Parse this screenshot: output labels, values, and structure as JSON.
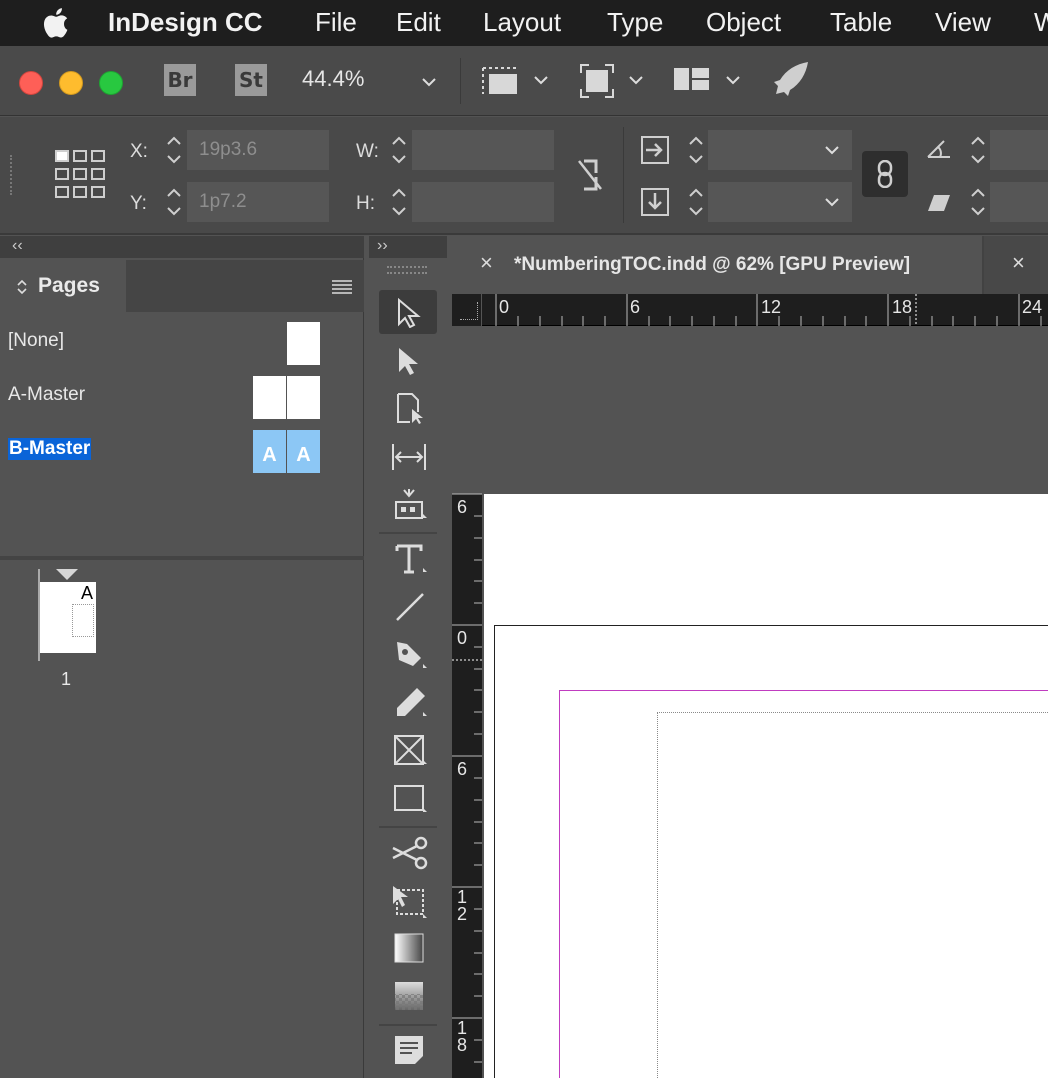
{
  "menubar": {
    "apple_icon": "apple-icon",
    "app_name": "InDesign CC",
    "items": [
      "File",
      "Edit",
      "Layout",
      "Type",
      "Object",
      "Table",
      "View",
      "W"
    ]
  },
  "appbar": {
    "bridge_label": "Br",
    "stock_label": "St",
    "zoom": "44.4%"
  },
  "control": {
    "x_label": "X:",
    "x_value": "19p3.6",
    "y_label": "Y:",
    "y_value": "1p7.2",
    "w_label": "W:",
    "w_value": "",
    "h_label": "H:",
    "h_value": ""
  },
  "pages_panel": {
    "collapse_glyph": "‹‹",
    "expand_glyph": "››",
    "tab_label": "Pages",
    "masters": [
      "[None]",
      "A-Master",
      "B-Master"
    ],
    "b_master_prefix": [
      "A",
      "A"
    ],
    "page_prefix": "A",
    "page_number": "1"
  },
  "document": {
    "tab_title": "*NumberingTOC.indd @ 62% [GPU Preview]",
    "close_glyph": "×",
    "ruler_h": [
      "0",
      "6",
      "12",
      "18",
      "24"
    ],
    "ruler_v": [
      "6",
      "0",
      "6",
      "1\n2",
      "1\n8"
    ]
  },
  "colors": {
    "menubar_bg": "#1e1e1e",
    "panel_bg": "#535353",
    "selection_blue": "#0a64d8",
    "margin_magenta": "#c03cc0",
    "thumb_blue": "#8cc7f5"
  }
}
